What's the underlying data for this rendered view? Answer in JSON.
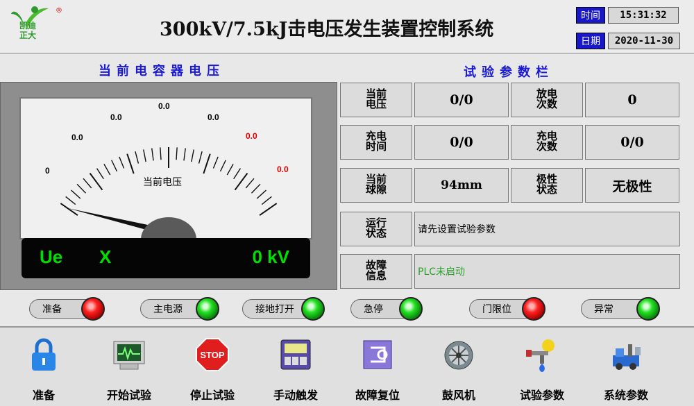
{
  "header": {
    "logo_text_1": "凯迪",
    "logo_text_2": "正大",
    "logo_mark": "®",
    "title": "300kV/7.5kJ击电压发生装置控制系统",
    "time_label": "时间",
    "time_value": "15:31:32",
    "date_label": "日期",
    "date_value": "2020-11-30"
  },
  "gauge": {
    "section_title": "当前电容器电压",
    "scale_labels": [
      "0",
      "0.0",
      "0.0",
      "0.0",
      "0.0",
      "0.0",
      "0.0"
    ],
    "center_label": "当前电压",
    "readout_symbol": "Ue",
    "readout_channel": "X",
    "readout_value": "0 kV"
  },
  "params": {
    "section_title": "试验参数栏",
    "current_voltage_label": "当前电压",
    "current_voltage_value": "0/0",
    "discharge_count_label": "放电次数",
    "discharge_count_value": "0",
    "charge_time_label": "充电时间",
    "charge_time_value": "0/0",
    "charge_count_label": "充电次数",
    "charge_count_value": "0/0",
    "ball_gap_label": "当前球隙",
    "ball_gap_value": "94mm",
    "polarity_label": "极性状态",
    "polarity_value": "无极性",
    "run_status_label": "运行状态",
    "run_status_value": "请先设置试验参数",
    "fault_label": "故障信息",
    "fault_value": "PLC未启动"
  },
  "status": [
    {
      "label": "准备",
      "state": "red"
    },
    {
      "label": "主电源",
      "state": "green"
    },
    {
      "label": "接地打开",
      "state": "green"
    },
    {
      "label": "急停",
      "state": "green"
    },
    {
      "label": "门限位",
      "state": "red"
    },
    {
      "label": "异常",
      "state": "green"
    }
  ],
  "toolbar": [
    {
      "label": "准备",
      "icon": "lock-icon"
    },
    {
      "label": "开始试验",
      "icon": "monitor-icon"
    },
    {
      "label": "停止试验",
      "icon": "stop-sign-icon"
    },
    {
      "label": "手动触发",
      "icon": "control-panel-icon"
    },
    {
      "label": "故障复位",
      "icon": "reset-icon"
    },
    {
      "label": "鼓风机",
      "icon": "blower-icon"
    },
    {
      "label": "试验参数",
      "icon": "gas-burner-icon"
    },
    {
      "label": "系统参数",
      "icon": "machinery-icon"
    }
  ],
  "colors": {
    "title_blue": "#1a1ad6",
    "lamp_red": "#ff2020",
    "lamp_green": "#22e022",
    "readout_green": "#00e000",
    "scale_red": "#e00000",
    "fault_text": "#2aa02a"
  },
  "needle_value": 0
}
